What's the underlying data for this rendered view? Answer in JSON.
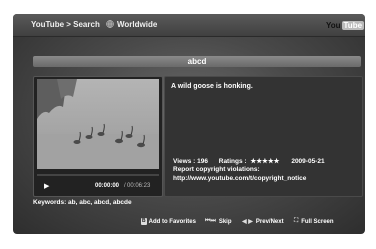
{
  "header": {
    "breadcrumb": "YouTube > Search",
    "region": "Worldwide",
    "region_icon": "globe-icon",
    "logo_you": "You",
    "logo_tube": "Tube"
  },
  "video": {
    "title": "abcd",
    "description": "A wild goose is honking.",
    "views_label": "Views : 196",
    "ratings_label": "Ratings :",
    "rating_stars": "★★★★★",
    "date": "2009-05-21",
    "copyright_label": "Report copyright violations:",
    "copyright_url": "http://www.youtube.com/t/copyright_notice",
    "keywords": "Keywords: ab, abc, abcd, abcde"
  },
  "player": {
    "current_time": "00:00:00",
    "separator": "/",
    "total_time": "00:06:23",
    "progress": 0,
    "play_icon": "play-icon"
  },
  "footer": {
    "favorites_key": "B",
    "favorites_label": "Add to Favorites",
    "skip_icon": "skip-icon",
    "skip_label": "Skip",
    "prevnext_icon": "prev-next-icon",
    "prevnext_label": "Prev/Next",
    "fullscreen_icon": "fullscreen-icon",
    "fullscreen_label": "Full Screen"
  }
}
